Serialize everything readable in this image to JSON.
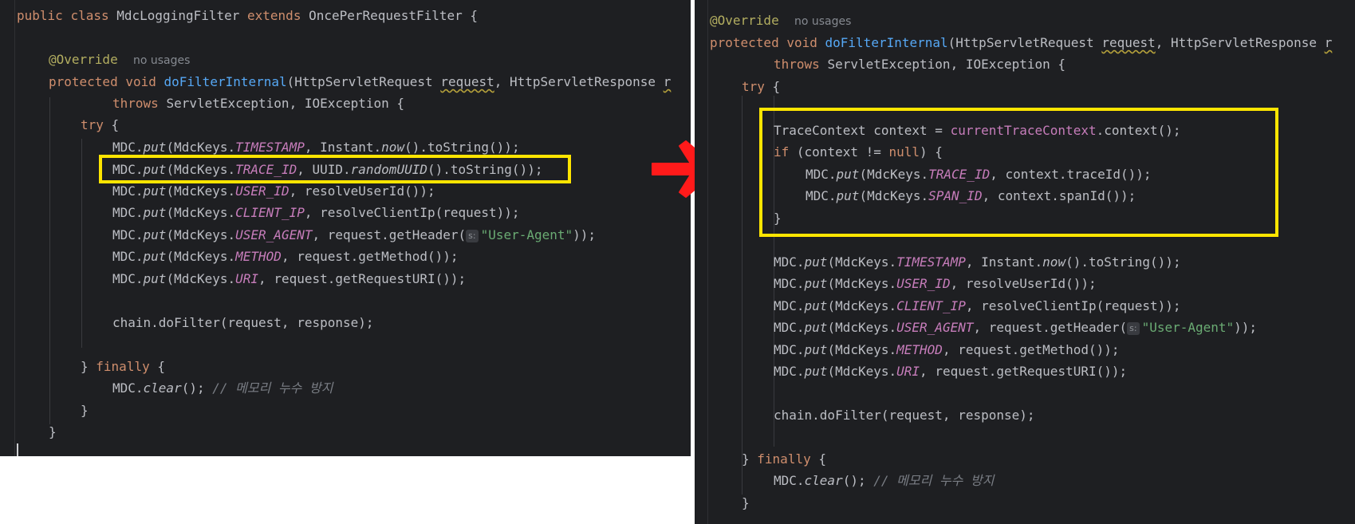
{
  "left": {
    "class_decl": {
      "kw_public": "public",
      "kw_class": "class",
      "class_name": "MdcLoggingFilter",
      "kw_extends": "extends",
      "super_name": "OncePerRequestFilter",
      "brace": "{"
    },
    "annotation": "@Override",
    "usages_hint": "no usages",
    "method": {
      "kw_protected": "protected",
      "kw_void": "void",
      "name": "doFilterInternal",
      "open": "(",
      "type1": "HttpServletRequest",
      "param1": "request",
      "sep": ", ",
      "type2": "HttpServletResponse",
      "param2_start": "r"
    },
    "throws_line": {
      "kw_throws": "throws",
      "rest": "ServletException, IOException {"
    },
    "try_line": {
      "kw_try": "try",
      "rest": "{"
    },
    "puts": [
      {
        "prefix": "MDC.",
        "method": "put",
        "mid": "(MdcKeys.",
        "key": "TIMESTAMP",
        "arg_pre": ", Instant.",
        "arg_static": "now",
        "arg_post": "().toString());"
      },
      {
        "prefix": "MDC.",
        "method": "put",
        "mid": "(MdcKeys.",
        "key": "TRACE_ID",
        "arg_pre": ", UUID.",
        "arg_static": "randomUUID",
        "arg_post": "().toString());"
      },
      {
        "prefix": "MDC.",
        "method": "put",
        "mid": "(MdcKeys.",
        "key": "USER_ID",
        "arg_pre": ", resolveUserId());",
        "arg_static": "",
        "arg_post": ""
      },
      {
        "prefix": "MDC.",
        "method": "put",
        "mid": "(MdcKeys.",
        "key": "CLIENT_IP",
        "arg_pre": ", resolveClientIp(request));",
        "arg_static": "",
        "arg_post": ""
      },
      {
        "prefix": "MDC.",
        "method": "put",
        "mid": "(MdcKeys.",
        "key": "USER_AGENT",
        "arg_pre": ", request.getHeader(",
        "param_hint": "s:",
        "str": "\"User-Agent\"",
        "arg_post": "));"
      },
      {
        "prefix": "MDC.",
        "method": "put",
        "mid": "(MdcKeys.",
        "key": "METHOD",
        "arg_pre": ", request.getMethod());",
        "arg_static": "",
        "arg_post": ""
      },
      {
        "prefix": "MDC.",
        "method": "put",
        "mid": "(MdcKeys.",
        "key": "URI",
        "arg_pre": ", request.getRequestURI());",
        "arg_static": "",
        "arg_post": ""
      }
    ],
    "chain_line": "chain.doFilter(request, response);",
    "finally_line": {
      "close": "}",
      "kw_finally": "finally",
      "open": "{"
    },
    "clear_line": {
      "prefix": "MDC.",
      "method": "clear",
      "post": "();",
      "comment": "// 메모리 누수 방지"
    },
    "close_try": "}",
    "close_method": "}"
  },
  "right": {
    "annotation": "@Override",
    "usages_hint": "no usages",
    "method": {
      "kw_protected": "protected",
      "kw_void": "void",
      "name": "doFilterInternal",
      "open": "(",
      "type1": "HttpServletRequest",
      "param1": "request",
      "sep": ", ",
      "type2": "HttpServletResponse",
      "param2_start": "r"
    },
    "throws_line": {
      "kw_throws": "throws",
      "rest": "ServletException, IOException {"
    },
    "try_line": {
      "kw_try": "try",
      "rest": "{"
    },
    "trace_line": {
      "pre": "TraceContext context = ",
      "field": "currentTraceContext",
      "post": ".context();"
    },
    "if_line": {
      "kw_if": "if",
      "mid": "(context != ",
      "kw_null": "null",
      "post": ") {"
    },
    "trace_puts": [
      {
        "prefix": "MDC.",
        "method": "put",
        "mid": "(MdcKeys.",
        "key": "TRACE_ID",
        "post": ", context.traceId());"
      },
      {
        "prefix": "MDC.",
        "method": "put",
        "mid": "(MdcKeys.",
        "key": "SPAN_ID",
        "post": ", context.spanId());"
      }
    ],
    "if_close": "}",
    "puts": [
      {
        "prefix": "MDC.",
        "method": "put",
        "mid": "(MdcKeys.",
        "key": "TIMESTAMP",
        "arg_pre": ", Instant.",
        "arg_static": "now",
        "arg_post": "().toString());"
      },
      {
        "prefix": "MDC.",
        "method": "put",
        "mid": "(MdcKeys.",
        "key": "USER_ID",
        "arg_pre": ", resolveUserId());",
        "arg_static": "",
        "arg_post": ""
      },
      {
        "prefix": "MDC.",
        "method": "put",
        "mid": "(MdcKeys.",
        "key": "CLIENT_IP",
        "arg_pre": ", resolveClientIp(request));",
        "arg_static": "",
        "arg_post": ""
      },
      {
        "prefix": "MDC.",
        "method": "put",
        "mid": "(MdcKeys.",
        "key": "USER_AGENT",
        "arg_pre": ", request.getHeader(",
        "param_hint": "s:",
        "str": "\"User-Agent\"",
        "arg_post": "));"
      },
      {
        "prefix": "MDC.",
        "method": "put",
        "mid": "(MdcKeys.",
        "key": "METHOD",
        "arg_pre": ", request.getMethod());",
        "arg_static": "",
        "arg_post": ""
      },
      {
        "prefix": "MDC.",
        "method": "put",
        "mid": "(MdcKeys.",
        "key": "URI",
        "arg_pre": ", request.getRequestURI());",
        "arg_static": "",
        "arg_post": ""
      }
    ],
    "chain_line": "chain.doFilter(request, response);",
    "finally_line": {
      "close": "}",
      "kw_finally": "finally",
      "open": "{"
    },
    "clear_line": {
      "prefix": "MDC.",
      "method": "clear",
      "post": "();",
      "comment": "// 메모리 누수 방지"
    },
    "close_try": "}"
  },
  "colors": {
    "editor_bg": "#1e1f22",
    "highlight_box": "#ffe500",
    "arrow": "#ff1a1a"
  },
  "icons": {
    "arrow": "right-arrow-icon"
  }
}
